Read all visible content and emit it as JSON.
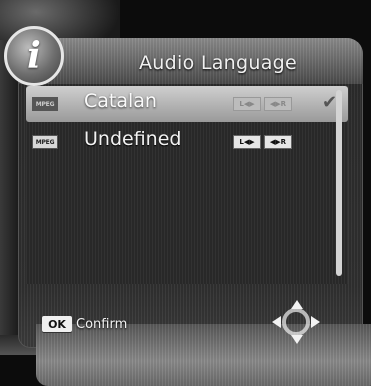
{
  "dialog": {
    "title": "Audio Language",
    "info_icon_glyph": "i"
  },
  "tracks": [
    {
      "codec": "MPEG",
      "language": "Catalan",
      "left_channel": "L◀▶",
      "right_channel": "◀▶R",
      "selected": true
    },
    {
      "codec": "MPEG",
      "language": "Undefined",
      "left_channel": "L◀▶",
      "right_channel": "◀▶R",
      "selected": false
    }
  ],
  "footer": {
    "ok_key": "OK",
    "confirm_label": "Confirm"
  },
  "icons": {
    "info": "info-icon",
    "check": "check-icon",
    "navigation": "dpad-icon"
  }
}
